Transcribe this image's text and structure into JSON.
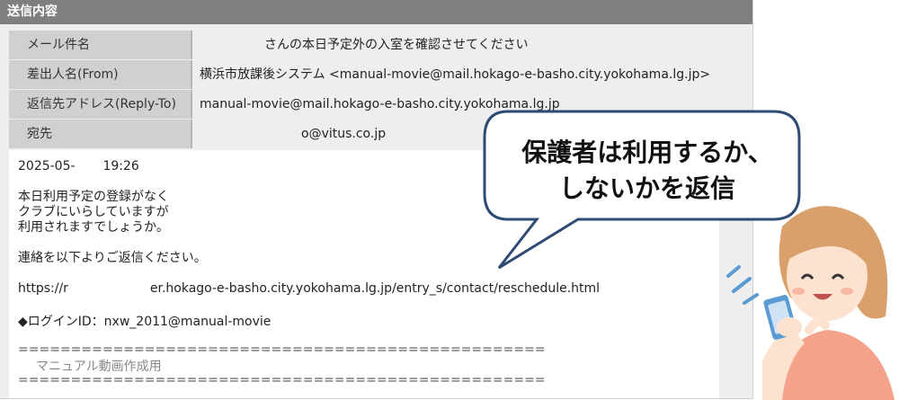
{
  "header": {
    "title": "送信内容"
  },
  "fields": [
    {
      "label": "メール件名",
      "value": "さんの本日予定外の入室を確認させてください"
    },
    {
      "label": "差出人名(From)",
      "value": "横浜市放課後システム <manual-movie@mail.hokago-e-basho.city.yokohama.lg.jp>"
    },
    {
      "label": "返信先アドレス(Reply-To)",
      "value": "manual-movie@mail.hokago-e-basho.city.yokohama.lg.jp"
    },
    {
      "label": "宛先",
      "value": "o@vitus.co.jp"
    }
  ],
  "message": {
    "date_start": "2025-05-",
    "date_end": "19:26",
    "line1": "本日利用予定の登録がなく",
    "line2": "クラブにいらしていますが",
    "line3": "利用されますでしょうか。",
    "line4": "連絡を以下よりご返信ください。",
    "url_start": "https://r",
    "url_end": "er.hokago-e-basho.city.yokohama.lg.jp/entry_s/contact/reschedule.html",
    "login": "◆ログインID：nxw_2011@manual-movie",
    "divider1": "==================================================",
    "footer_text": "マニュアル動画作成用",
    "divider2": "=================================================="
  },
  "callout": {
    "line1": "保護者は利用するか、",
    "line2": "しないかを返信"
  },
  "colors": {
    "header_bg": "#7f7f7f",
    "label_bg": "#d0d0d0",
    "bubble_border": "#2f4a73",
    "hair": "#d9a06b",
    "shirt": "#f4a38a",
    "phone": "#5a9bd4"
  }
}
